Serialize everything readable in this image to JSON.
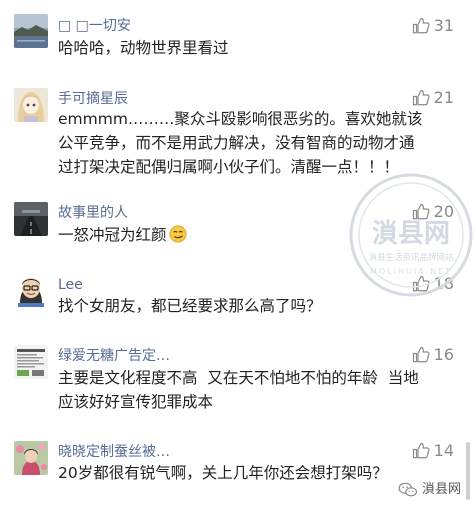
{
  "comments": [
    {
      "username": "□ □一切安",
      "likes": "31",
      "lines": [
        "哈哈哈，动物世界里看过"
      ],
      "avatar": "lake-landscape-avatar"
    },
    {
      "username": "手可摘星辰",
      "likes": "21",
      "lines": [
        "emmmm………聚众斗殴影响很恶劣的。喜欢她就该",
        "公平竞争，而不是用武力解决，没有智商的动物才通",
        "过打架决定配偶归属啊小伙子们。清醒一点！！！"
      ],
      "avatar": "anime-girl-avatar"
    },
    {
      "username": "故事里的人",
      "likes": "20",
      "lines": [
        "一怒冲冠为红颜"
      ],
      "emoji": "smirk-emoji",
      "avatar": "dark-road-avatar"
    },
    {
      "username": "Lee",
      "likes": "18",
      "lines": [
        "找个女朋友，都已经要求那么高了吗？"
      ],
      "avatar": "cartoon-man-avatar"
    },
    {
      "username": "绿爱无糖广告定…",
      "likes": "16",
      "lines": [
        "主要是文化程度不高  又在天不怕地不怕的年龄  当地",
        "应该好好宣传犯罪成本"
      ],
      "avatar": "text-card-avatar"
    },
    {
      "username": "晓晓定制蚕丝被…",
      "likes": "14",
      "lines": [
        "20岁都很有锐气啊，关上几年你还会想打架吗？"
      ],
      "avatar": "flower-woman-avatar"
    }
  ],
  "watermark": {
    "big_text": "溑县网",
    "sub_text": "溑县生活资讯品牌网站",
    "latin_text": "MOLIHUIA.NET"
  },
  "brand": {
    "label": "溑县网"
  },
  "colors": {
    "username": "#576b95",
    "like": "#8a8a8a",
    "text": "#222222"
  }
}
